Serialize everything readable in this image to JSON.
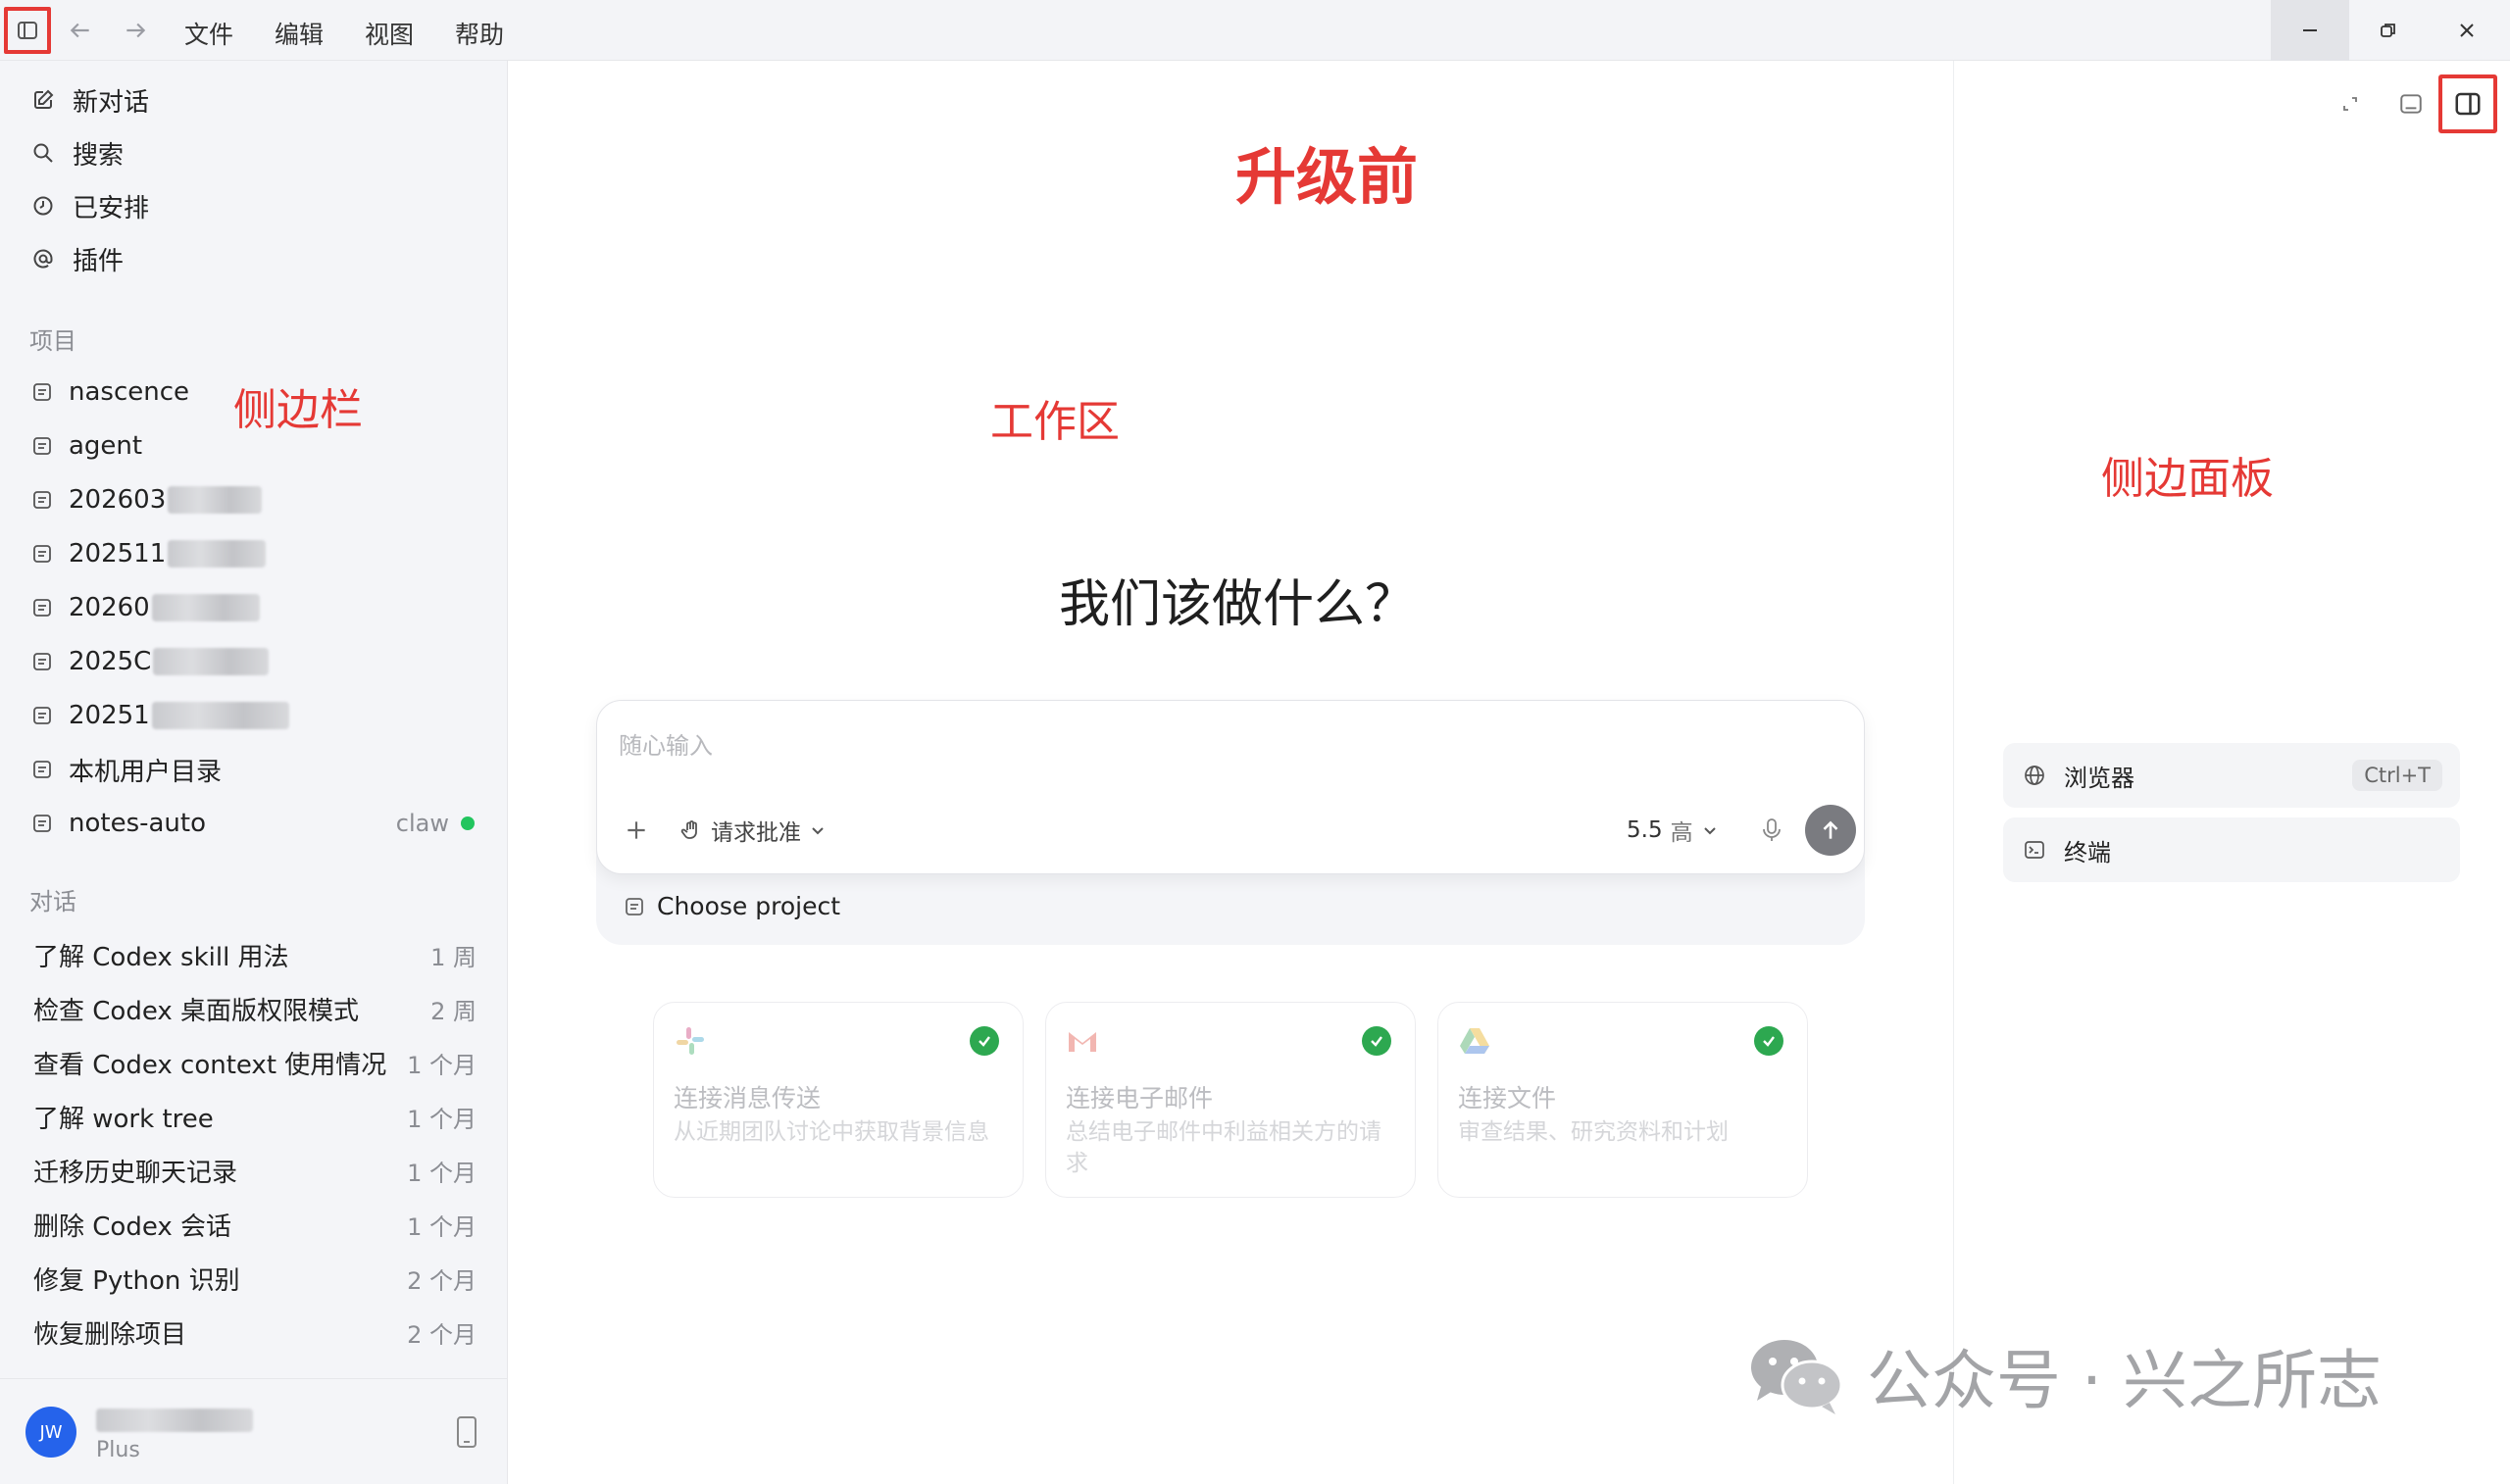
{
  "titlebar": {
    "menus": [
      "文件",
      "编辑",
      "视图",
      "帮助"
    ]
  },
  "sidebar": {
    "nav": [
      {
        "label": "新对话",
        "icon": "edit-icon"
      },
      {
        "label": "搜索",
        "icon": "search-icon"
      },
      {
        "label": "已安排",
        "icon": "clock-icon"
      },
      {
        "label": "插件",
        "icon": "at-icon"
      }
    ],
    "projects_label": "项目",
    "projects": [
      {
        "label": "nascence",
        "badge": ""
      },
      {
        "label": "agent",
        "badge": ""
      },
      {
        "label": "202603",
        "badge": ""
      },
      {
        "label": "202511",
        "badge": ""
      },
      {
        "label": "20260",
        "badge": ""
      },
      {
        "label": "2025C",
        "badge": ""
      },
      {
        "label": "20251",
        "badge": ""
      },
      {
        "label": "本机用户目录",
        "badge": ""
      },
      {
        "label": "notes-auto",
        "badge": "claw"
      }
    ],
    "conversations_label": "对话",
    "conversations": [
      {
        "title": "了解 Codex skill 用法",
        "time": "1 周"
      },
      {
        "title": "检查 Codex 桌面版权限模式",
        "time": "2 周"
      },
      {
        "title": "查看 Codex context 使用情况",
        "time": "1 个月"
      },
      {
        "title": "了解 work tree",
        "time": "1 个月"
      },
      {
        "title": "迁移历史聊天记录",
        "time": "1 个月"
      },
      {
        "title": "删除 Codex 会话",
        "time": "1 个月"
      },
      {
        "title": "修复 Python 识别",
        "time": "2 个月"
      },
      {
        "title": "恢复删除项目",
        "time": "2 个月"
      }
    ],
    "user": {
      "avatar": "JW",
      "plan": "Plus"
    }
  },
  "annotations": {
    "headline": "升级前",
    "sidebar": "侧边栏",
    "workspace": "工作区",
    "sidepanel": "侧边面板"
  },
  "workspace": {
    "title": "我们该做什么？",
    "composer": {
      "placeholder": "随心输入",
      "approval": "请求批准",
      "model": "5.5",
      "level": "高"
    },
    "project_chip": "Choose project",
    "cards": [
      {
        "title": "连接消息传送",
        "desc": "从近期团队讨论中获取背景信息",
        "logo": "slack-logo-icon"
      },
      {
        "title": "连接电子邮件",
        "desc": "总结电子邮件中利益相关方的请求",
        "logo": "gmail-logo-icon"
      },
      {
        "title": "连接文件",
        "desc": "审查结果、研究资料和计划",
        "logo": "drive-logo-icon"
      }
    ]
  },
  "sidepanel": {
    "items": [
      {
        "label": "浏览器",
        "shortcut": "Ctrl+T",
        "icon": "globe-icon"
      },
      {
        "label": "终端",
        "shortcut": "",
        "icon": "terminal-icon"
      }
    ]
  },
  "watermark": "公众号 · 兴之所志",
  "colors": {
    "annotation_red": "#e53935",
    "status_green": "#22c55e"
  }
}
